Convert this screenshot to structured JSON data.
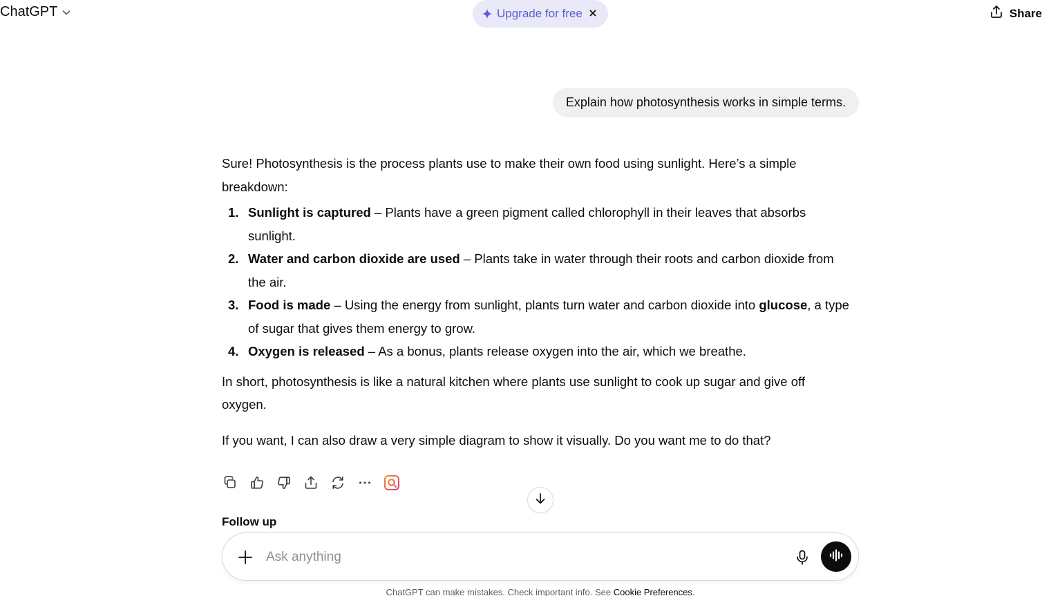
{
  "header": {
    "model_name": "ChatGPT",
    "upgrade_label": "Upgrade for free",
    "share_label": "Share"
  },
  "conversation": {
    "user_message": "Explain how photosynthesis works in simple terms.",
    "assistant": {
      "intro": "Sure! Photosynthesis is the process plants use to make their own food using sunlight. Here’s a simple breakdown:",
      "steps": [
        {
          "num": "1.",
          "title": "Sunlight is captured",
          "text": " – Plants have a green pigment called chlorophyll in their leaves that absorbs sunlight."
        },
        {
          "num": "2.",
          "title": "Water and carbon dioxide are used",
          "text": " – Plants take in water through their roots and carbon dioxide from the air."
        },
        {
          "num": "3.",
          "title": "Food is made",
          "text_before": " – Using the energy from sunlight, plants turn water and carbon dioxide into ",
          "bold_word": "glucose",
          "text_after": ", a type of sugar that gives them energy to grow."
        },
        {
          "num": "4.",
          "title": "Oxygen is released",
          "text": " – As a bonus, plants release oxygen into the air, which we breathe."
        }
      ],
      "summary": "In short, photosynthesis is like a natural kitchen where plants use sunlight to cook up sugar and give off oxygen.",
      "offer": "If you want, I can also draw a very simple diagram to show it visually. Do you want me to do that?"
    },
    "action_icons": [
      "copy-icon",
      "thumbs-up-icon",
      "thumbs-down-icon",
      "share-icon",
      "regenerate-icon",
      "more-icon",
      "image-search-icon"
    ]
  },
  "follow_up_label": "Follow up",
  "composer": {
    "placeholder": "Ask anything",
    "value": ""
  },
  "footer": {
    "note": "ChatGPT can make mistakes. Check important info. See ",
    "link": "Cookie Preferences",
    "note_end": "."
  },
  "colors": {
    "accent": "#5b5bd6",
    "upgrade_bg": "#e9e9f7",
    "user_bubble": "#f0f0f0",
    "voice_button": "#0d0d0d"
  }
}
